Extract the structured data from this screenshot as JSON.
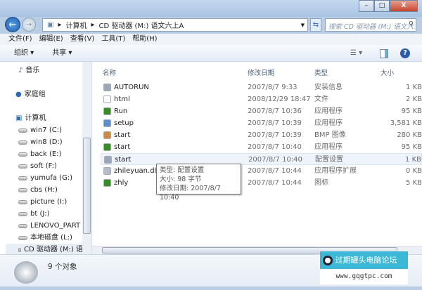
{
  "window": {
    "minimize": "–",
    "maximize": "□",
    "close": "X"
  },
  "address": {
    "path": [
      "计算机",
      "CD 驱动器 (M:) 语文六上A"
    ],
    "search_placeholder": "搜索 CD 驱动器 (M:) 语文六..."
  },
  "menu": [
    "文件(F)",
    "编辑(E)",
    "查看(V)",
    "工具(T)",
    "帮助(H)"
  ],
  "toolbar": {
    "organize": "组织 ▾",
    "share": "共享 ▾"
  },
  "nav": [
    {
      "label": "音乐",
      "icon": "music-icon"
    },
    {
      "label": "家庭组",
      "icon": "homegroup-icon"
    },
    {
      "label": "计算机",
      "icon": "computer-icon"
    },
    {
      "label": "win7 (C:)",
      "icon": "drive-icon"
    },
    {
      "label": "win8 (D:)",
      "icon": "drive-icon"
    },
    {
      "label": "back (E:)",
      "icon": "drive-icon"
    },
    {
      "label": "soft (F:)",
      "icon": "drive-icon"
    },
    {
      "label": "yumufa (G:)",
      "icon": "drive-icon"
    },
    {
      "label": "cbs (H:)",
      "icon": "drive-icon"
    },
    {
      "label": "picture (I:)",
      "icon": "drive-icon"
    },
    {
      "label": "bt (J:)",
      "icon": "drive-icon"
    },
    {
      "label": "LENOVO_PART (",
      "icon": "drive-icon"
    },
    {
      "label": "本地磁盘 (L:)",
      "icon": "drive-icon"
    },
    {
      "label": "CD 驱动器 (M:) 语",
      "icon": "cd-drive-icon"
    }
  ],
  "columns": {
    "name": "名称",
    "date": "修改日期",
    "type": "类型",
    "size": "大小"
  },
  "files": [
    {
      "name": "AUTORUN",
      "date": "2007/8/7 9:33",
      "type": "安装信息",
      "size": "1 KB",
      "icon": "settings-file-icon",
      "color": "#9aa7b8"
    },
    {
      "name": "html",
      "date": "2008/12/29 18:47",
      "type": "文件",
      "size": "2 KB",
      "icon": "blank-file-icon",
      "color": "#ffffff"
    },
    {
      "name": "Run",
      "date": "2007/8/7 10:36",
      "type": "应用程序",
      "size": "95 KB",
      "icon": "app-icon",
      "color": "#3b8a2a"
    },
    {
      "name": "setup",
      "date": "2007/8/7 10:39",
      "type": "应用程序",
      "size": "3,581 KB",
      "icon": "setup-icon",
      "color": "#5c8fc9"
    },
    {
      "name": "start",
      "date": "2007/8/7 10:39",
      "type": "BMP 图像",
      "size": "280 KB",
      "icon": "image-icon",
      "color": "#c98a4a"
    },
    {
      "name": "start",
      "date": "2007/8/7 10:40",
      "type": "应用程序",
      "size": "95 KB",
      "icon": "app-icon",
      "color": "#3b8a2a"
    },
    {
      "name": "start",
      "date": "2007/8/7 10:40",
      "type": "配置设置",
      "size": "1 KB",
      "icon": "settings-file-icon",
      "color": "#9aa7b8"
    },
    {
      "name": "zhileyuan.dll",
      "date": "2007/8/7 10:44",
      "type": "应用程序扩展",
      "size": "0 KB",
      "icon": "dll-icon",
      "color": "#b4bcc8"
    },
    {
      "name": "zhly",
      "date": "2007/8/7 10:44",
      "type": "图标",
      "size": "5 KB",
      "icon": "app-icon",
      "color": "#3b8a2a"
    }
  ],
  "tooltip": {
    "type": "类型: 配置设置",
    "size": "大小: 98 字节",
    "date": "修改日期: 2007/8/7 10:40"
  },
  "status": {
    "count": "9 个对象"
  },
  "watermark": {
    "name": "过期罐头电脑论坛",
    "url": "www.gqgtpc.com"
  }
}
